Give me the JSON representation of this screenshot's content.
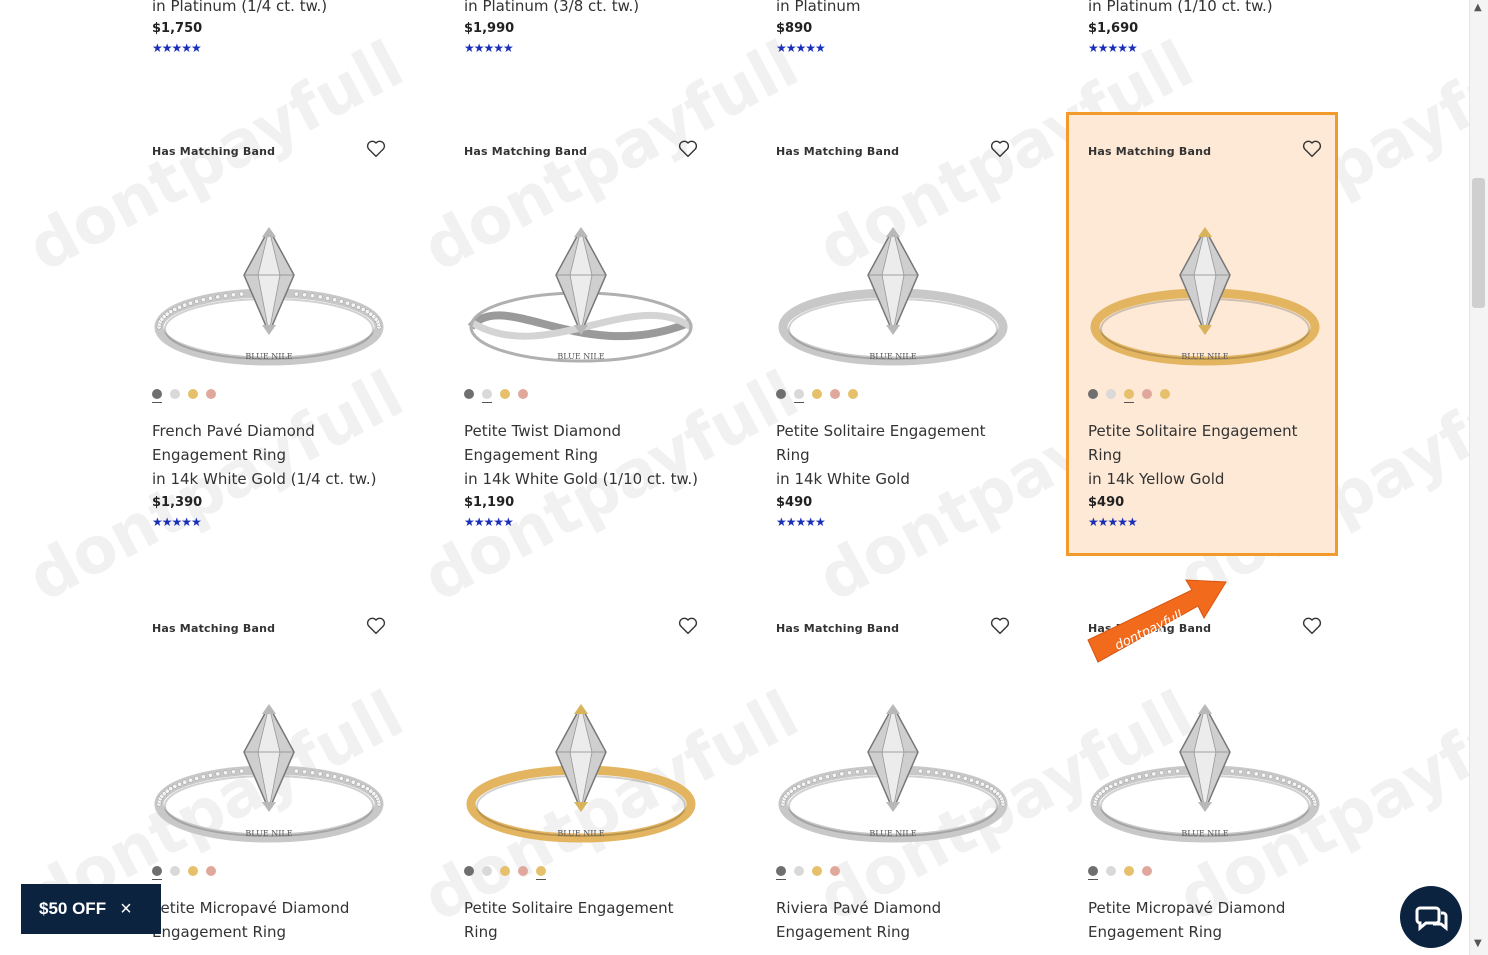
{
  "top_row": [
    {
      "line": "in Platinum (1/4 ct. tw.)",
      "price": "$1,750",
      "stars": "★★★★★"
    },
    {
      "line": "in Platinum (3/8 ct. tw.)",
      "price": "$1,990",
      "stars": "★★★★★"
    },
    {
      "line": "in Platinum",
      "price": "$890",
      "stars": "★★★★★"
    },
    {
      "line": "in Platinum (1/10 ct. tw.)",
      "price": "$1,690",
      "stars": "★★★★★"
    }
  ],
  "row2": [
    {
      "badge": "Has Matching Band",
      "name1": "French Pavé Diamond",
      "name2": "Engagement Ring",
      "metal": "in 14k White Gold (1/4 ct. tw.)",
      "price": "$1,390",
      "stars": "★★★★★",
      "band_color": "#c8c8c8",
      "style": "pave"
    },
    {
      "badge": "Has Matching Band",
      "name1": "Petite Twist Diamond",
      "name2": "Engagement Ring",
      "metal": "in 14k White Gold (1/10 ct. tw.)",
      "price": "$1,190",
      "stars": "★★★★★",
      "band_color": "#c8c8c8",
      "style": "twist"
    },
    {
      "badge": "Has Matching Band",
      "name1": "Petite Solitaire Engagement",
      "name2": "Ring",
      "metal": "in 14k White Gold",
      "price": "$490",
      "stars": "★★★★★",
      "band_color": "#c8c8c8",
      "style": "plain"
    },
    {
      "badge": "Has Matching Band",
      "name1": "Petite Solitaire Engagement",
      "name2": "Ring",
      "metal": "in 14k Yellow Gold",
      "price": "$490",
      "stars": "★★★★★",
      "band_color": "#e3b560",
      "style": "plain"
    }
  ],
  "row3": [
    {
      "badge": "Has Matching Band",
      "name1": "Petite Micropavé Diamond",
      "name2": "Engagement Ring",
      "band_color": "#c8c8c8",
      "style": "pave"
    },
    {
      "badge": "",
      "name1": "Petite Solitaire Engagement",
      "name2": "Ring",
      "band_color": "#e3b560",
      "style": "plain"
    },
    {
      "badge": "Has Matching Band",
      "name1": "Riviera Pavé Diamond",
      "name2": "Engagement Ring",
      "band_color": "#c8c8c8",
      "style": "pave"
    },
    {
      "badge": "Has Matching Band",
      "name1": "Petite Micropavé Diamond",
      "name2": "Engagement Ring",
      "band_color": "#c8c8c8",
      "style": "pave"
    }
  ],
  "swatch_colors": {
    "dark": "#6f6f6f",
    "white": "#d9d9d9",
    "yellow": "#e6c06a",
    "rose": "#e0a89c"
  },
  "promo": {
    "label": "$50 OFF",
    "close": "×"
  },
  "brand_mark": "BLUE NILE",
  "watermark": "dontpayfull",
  "arrow_label": "dontpayfull",
  "icons": {
    "heart": "heart-icon",
    "chat": "chat-icon",
    "close": "close-icon"
  }
}
